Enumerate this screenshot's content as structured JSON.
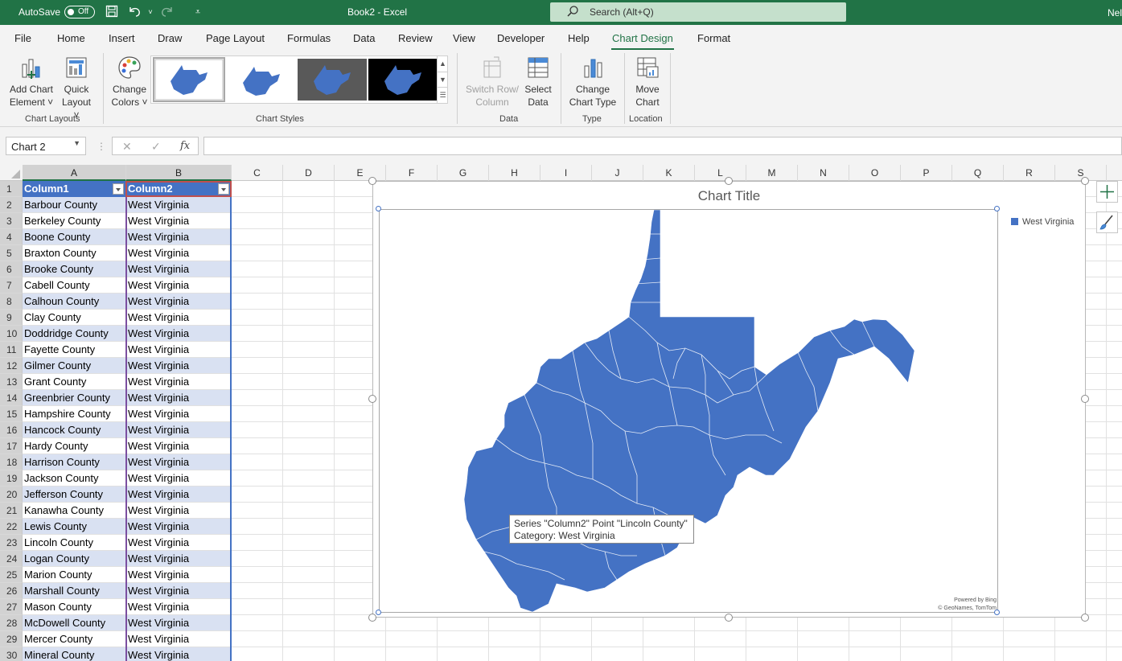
{
  "titlebar": {
    "autosave_label": "AutoSave",
    "autosave_state": "Off",
    "doc_title": "Book2  -  Excel",
    "search_placeholder": "Search (Alt+Q)",
    "user_initials": "Nel"
  },
  "menu": {
    "tabs": [
      "File",
      "Home",
      "Insert",
      "Draw",
      "Page Layout",
      "Formulas",
      "Data",
      "Review",
      "View",
      "Developer",
      "Help",
      "Chart Design",
      "Format"
    ],
    "active": "Chart Design"
  },
  "ribbon": {
    "add_chart_element": [
      "Add Chart",
      "Element ˅"
    ],
    "quick_layout": [
      "Quick",
      "Layout ˅"
    ],
    "change_colors": [
      "Change",
      "Colors ˅"
    ],
    "switch_row_col": [
      "Switch Row/",
      "Column"
    ],
    "select_data": [
      "Select",
      "Data"
    ],
    "change_chart_type": [
      "Change",
      "Chart Type"
    ],
    "move_chart": [
      "Move",
      "Chart"
    ],
    "groups": {
      "chart_layouts": "Chart Layouts",
      "chart_styles": "Chart Styles",
      "data": "Data",
      "type": "Type",
      "location": "Location"
    }
  },
  "formula_bar": {
    "name_box": "Chart 2",
    "cancel": "✕",
    "enter": "✓",
    "fx": "fx",
    "value": ""
  },
  "sheet": {
    "columns": [
      "A",
      "B",
      "C",
      "D",
      "E",
      "F",
      "G",
      "H",
      "I",
      "J",
      "K",
      "L",
      "M",
      "N",
      "O",
      "P",
      "Q",
      "R",
      "S"
    ],
    "row_numbers": [
      "1",
      "2",
      "3",
      "4",
      "5",
      "6",
      "7",
      "8",
      "9",
      "10",
      "11",
      "12",
      "13",
      "14",
      "15",
      "16",
      "17",
      "18",
      "19",
      "20",
      "21",
      "22",
      "23",
      "24",
      "25",
      "26",
      "27",
      "28",
      "29",
      "30"
    ],
    "headers": [
      "Column1",
      "Column2"
    ],
    "rows": [
      [
        "Barbour County",
        "West Virginia"
      ],
      [
        "Berkeley County",
        "West Virginia"
      ],
      [
        "Boone County",
        "West Virginia"
      ],
      [
        "Braxton County",
        "West Virginia"
      ],
      [
        "Brooke County",
        "West Virginia"
      ],
      [
        "Cabell County",
        "West Virginia"
      ],
      [
        "Calhoun County",
        "West Virginia"
      ],
      [
        "Clay County",
        "West Virginia"
      ],
      [
        "Doddridge County",
        "West Virginia"
      ],
      [
        "Fayette County",
        "West Virginia"
      ],
      [
        "Gilmer County",
        "West Virginia"
      ],
      [
        "Grant County",
        "West Virginia"
      ],
      [
        "Greenbrier County",
        "West Virginia"
      ],
      [
        "Hampshire County",
        "West Virginia"
      ],
      [
        "Hancock County",
        "West Virginia"
      ],
      [
        "Hardy County",
        "West Virginia"
      ],
      [
        "Harrison County",
        "West Virginia"
      ],
      [
        "Jackson County",
        "West Virginia"
      ],
      [
        "Jefferson County",
        "West Virginia"
      ],
      [
        "Kanawha County",
        "West Virginia"
      ],
      [
        "Lewis County",
        "West Virginia"
      ],
      [
        "Lincoln County",
        "West Virginia"
      ],
      [
        "Logan County",
        "West Virginia"
      ],
      [
        "Marion County",
        "West Virginia"
      ],
      [
        "Marshall County",
        "West Virginia"
      ],
      [
        "Mason County",
        "West Virginia"
      ],
      [
        "McDowell County",
        "West Virginia"
      ],
      [
        "Mercer County",
        "West Virginia"
      ],
      [
        "Mineral County",
        "West Virginia"
      ]
    ]
  },
  "chart": {
    "title": "Chart Title",
    "legend": "West Virginia",
    "attribution_1": "Powered by Bing",
    "attribution_2": "© GeoNames, TomTom",
    "fill_color": "#4472c4",
    "tooltip_line1": "Series \"Column2\" Point \"Lincoln County\"",
    "tooltip_line2": "Category: West Virginia"
  },
  "colors": {
    "excel_green": "#217346",
    "table_header": "#4472c4",
    "band": "#d9e1f2"
  }
}
